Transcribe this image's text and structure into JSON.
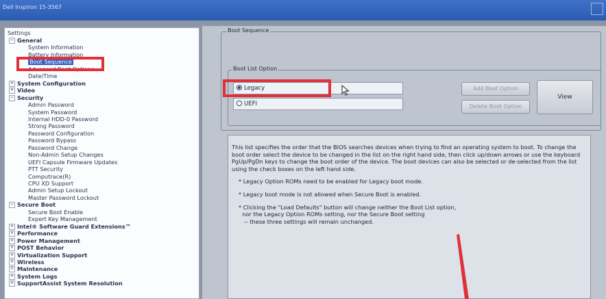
{
  "window": {
    "title": "Dell Inspiron 15-3567"
  },
  "tree": {
    "header": "Settings",
    "items": [
      {
        "label": "General",
        "indent": 0,
        "exp": "−",
        "root": true
      },
      {
        "label": "System Information",
        "indent": 2
      },
      {
        "label": "Battery Information",
        "indent": 2
      },
      {
        "label": "Boot Sequence",
        "indent": 2,
        "selected": true
      },
      {
        "label": "Advanced Boot Options",
        "indent": 2
      },
      {
        "label": "Date/Time",
        "indent": 2
      },
      {
        "label": "System Configuration",
        "indent": 0,
        "exp": "+",
        "root": true
      },
      {
        "label": "Video",
        "indent": 0,
        "exp": "+",
        "root": true
      },
      {
        "label": "Security",
        "indent": 0,
        "exp": "−",
        "root": true
      },
      {
        "label": "Admin Password",
        "indent": 2
      },
      {
        "label": "System Password",
        "indent": 2
      },
      {
        "label": "Internal HDD-0 Password",
        "indent": 2
      },
      {
        "label": "Strong Password",
        "indent": 2
      },
      {
        "label": "Password Configuration",
        "indent": 2
      },
      {
        "label": "Password Bypass",
        "indent": 2
      },
      {
        "label": "Password Change",
        "indent": 2
      },
      {
        "label": "Non-Admin Setup Changes",
        "indent": 2
      },
      {
        "label": "UEFI Capsule Firmware Updates",
        "indent": 2
      },
      {
        "label": "PTT Security",
        "indent": 2
      },
      {
        "label": "Computrace(R)",
        "indent": 2
      },
      {
        "label": "CPU XD Support",
        "indent": 2
      },
      {
        "label": "Admin Setup Lockout",
        "indent": 2
      },
      {
        "label": "Master Password Lockout",
        "indent": 2
      },
      {
        "label": "Secure Boot",
        "indent": 0,
        "exp": "−",
        "root": true
      },
      {
        "label": "Secure Boot Enable",
        "indent": 2
      },
      {
        "label": "Expert Key Management",
        "indent": 2
      },
      {
        "label": "Intel® Software Guard Extensions™",
        "indent": 0,
        "exp": "+",
        "root": true
      },
      {
        "label": "Performance",
        "indent": 0,
        "exp": "+",
        "root": true
      },
      {
        "label": "Power Management",
        "indent": 0,
        "exp": "+",
        "root": true
      },
      {
        "label": "POST Behavior",
        "indent": 0,
        "exp": "+",
        "root": true
      },
      {
        "label": "Virtualization Support",
        "indent": 0,
        "exp": "+",
        "root": true
      },
      {
        "label": "Wireless",
        "indent": 0,
        "exp": "+",
        "root": true
      },
      {
        "label": "Maintenance",
        "indent": 0,
        "exp": "+",
        "root": true
      },
      {
        "label": "System Logs",
        "indent": 0,
        "exp": "+",
        "root": true
      },
      {
        "label": "SupportAssist System Resolution",
        "indent": 0,
        "exp": "+",
        "root": true
      }
    ]
  },
  "boot_sequence": {
    "group_label": "Boot Sequence",
    "list_option_label": "Boot List Option",
    "options": [
      {
        "label": "Legacy",
        "selected": true
      },
      {
        "label": "UEFI",
        "selected": false
      }
    ],
    "add_button": "Add Boot Option",
    "delete_button": "Delete Boot Option",
    "view_button": "View"
  },
  "info": {
    "paragraph": "This list specifies the order that the BIOS searches devices when trying to find an operating system to boot. To change the boot order select the device to be changed in the list on the right hand side, then click up/down arrows or use the keyboard PgUp/PgDn keys to change the boot order of the device. The boot devices can also be selected or de-selected from the list using the check boxes on the left hand side.",
    "bullet1": "* Legacy Option ROMs need to be enabled for Legacy boot mode.",
    "bullet2": "* Legacy boot mode is not allowed when Secure Boot is enabled.",
    "bullet3_lines": [
      "* Clicking the \"Load Defaults\" button will change neither the Boot List option,",
      "  nor the Legacy Option ROMs setting, nor the Secure Boot setting",
      "   -- these three settings will remain unchanged."
    ]
  },
  "colors": {
    "highlight": "#e0303a",
    "selection": "#2f5cc0"
  }
}
